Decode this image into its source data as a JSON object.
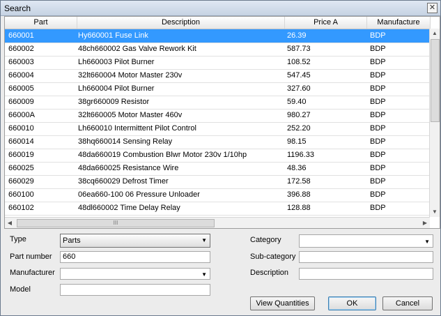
{
  "window": {
    "title": "Search",
    "close_glyph": "✕"
  },
  "table": {
    "columns": [
      "Part",
      "Description",
      "Price A",
      "Manufacture"
    ],
    "rows": [
      [
        "660001",
        "Hy660001 Fuse Link",
        "26.39",
        "BDP"
      ],
      [
        "660002",
        "48ch660002 Gas Valve Rework Kit",
        "587.73",
        "BDP"
      ],
      [
        "660003",
        "Lh660003 Pilot Burner",
        "108.52",
        "BDP"
      ],
      [
        "660004",
        "32lt660004 Motor Master 230v",
        "547.45",
        "BDP"
      ],
      [
        "660005",
        "Lh660004 Pilot Burner",
        "327.60",
        "BDP"
      ],
      [
        "660009",
        "38gr660009 Resistor",
        "59.40",
        "BDP"
      ],
      [
        "66000A",
        "32lt660005 Motor Master 460v",
        "980.27",
        "BDP"
      ],
      [
        "660010",
        "Lh660010 Intermittent Pilot Control",
        "252.20",
        "BDP"
      ],
      [
        "660014",
        "38hq660014 Sensing Relay",
        "98.15",
        "BDP"
      ],
      [
        "660019",
        "48da660019 Combustion Blwr Motor 230v 1/10hp",
        "1196.33",
        "BDP"
      ],
      [
        "660025",
        "48da660025 Resistance Wire",
        "48.36",
        "BDP"
      ],
      [
        "660029",
        "38cq660029 Defrost Timer",
        "172.58",
        "BDP"
      ],
      [
        "660100",
        "06ea660-100 06 Pressure Unloader",
        "396.88",
        "BDP"
      ],
      [
        "660102",
        "48dl660002 Time Delay Relay",
        "128.88",
        "BDP"
      ]
    ],
    "selected_row": 0,
    "hscroll_grip": "III"
  },
  "form": {
    "type_label": "Type",
    "type_value": "Parts",
    "part_number_label": "Part number",
    "part_number_value": "660",
    "manufacturer_label": "Manufacturer",
    "manufacturer_value": "",
    "model_label": "Model",
    "model_value": "",
    "category_label": "Category",
    "category_value": "",
    "subcategory_label": "Sub-category",
    "subcategory_value": "",
    "description_label": "Description",
    "description_value": ""
  },
  "buttons": {
    "view_quantities": "View Quantities",
    "ok": "OK",
    "cancel": "Cancel"
  }
}
